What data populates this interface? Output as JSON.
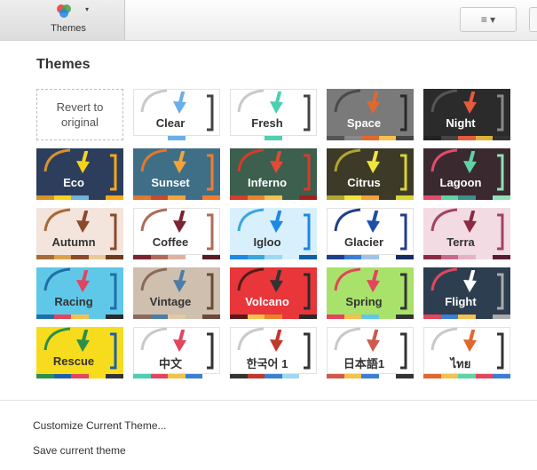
{
  "toolbar": {
    "themes_label": "Themes",
    "themes_caret": "▾",
    "menu_label": "≡ ▾",
    "logo_colors": [
      "#e53935",
      "#43a047",
      "#1e88e5"
    ]
  },
  "panel": {
    "title": "Themes",
    "revert_line1": "Revert to",
    "revert_line2": "original"
  },
  "themes": [
    {
      "name": "Clear",
      "bg": "#ffffff",
      "text": "#333333",
      "arc": "#c9c9c9",
      "arrow": "#6aaeea",
      "bracket": "#444444",
      "strip": [
        "#ffffff",
        "#ffffff",
        "#6aaeea",
        "#ffffff",
        "#ffffff"
      ]
    },
    {
      "name": "Fresh",
      "bg": "#ffffff",
      "text": "#333333",
      "arc": "#c9c9c9",
      "arrow": "#4dd0b1",
      "bracket": "#444444",
      "strip": [
        "#ffffff",
        "#ffffff",
        "#4dd0b1",
        "#ffffff",
        "#ffffff"
      ]
    },
    {
      "name": "Space",
      "bg": "#7a7a7a",
      "text": "#ffffff",
      "arc": "#4a4a4a",
      "arrow": "#e0682f",
      "bracket": "#2a2a2a",
      "strip": [
        "#555555",
        "#888888",
        "#e0682f",
        "#f2c14e",
        "#444444"
      ]
    },
    {
      "name": "Night",
      "bg": "#2b2b2b",
      "text": "#ffffff",
      "arc": "#555555",
      "arrow": "#e55b3c",
      "bracket": "#888888",
      "strip": [
        "#222222",
        "#444444",
        "#e55b3c",
        "#e0b03a",
        "#333333"
      ]
    },
    {
      "name": "Eco",
      "bg": "#2c3e5c",
      "text": "#ffffff",
      "arc": "#d9912b",
      "arrow": "#f7d21d",
      "bracket": "#f7a81d",
      "strip": [
        "#d9912b",
        "#f7d21d",
        "#6fb2dc",
        "#2c3e5c",
        "#f7a81d"
      ]
    },
    {
      "name": "Sunset",
      "bg": "#3f6f86",
      "text": "#ffffff",
      "arc": "#e0782f",
      "arrow": "#f2a33a",
      "bracket": "#f27b2f",
      "strip": [
        "#e0782f",
        "#c94a2e",
        "#f2a33a",
        "#3f6f86",
        "#f27b2f"
      ]
    },
    {
      "name": "Inferno",
      "bg": "#3c5f4e",
      "text": "#ffffff",
      "arc": "#d43c2c",
      "arrow": "#e14b33",
      "bracket": "#d43c2c",
      "strip": [
        "#d43c2c",
        "#e9822e",
        "#f2c14e",
        "#3c5f4e",
        "#a51f1f"
      ]
    },
    {
      "name": "Citrus",
      "bg": "#3d3a28",
      "text": "#ffffff",
      "arc": "#b0a531",
      "arrow": "#f0e63a",
      "bracket": "#d9d436",
      "strip": [
        "#b0a531",
        "#f0e63a",
        "#f2a33a",
        "#3d3a28",
        "#d9d436"
      ]
    },
    {
      "name": "Lagoon",
      "bg": "#3a2a2f",
      "text": "#ffffff",
      "arc": "#e24b6c",
      "arrow": "#5fd3a6",
      "bracket": "#8fe0b8",
      "strip": [
        "#e24b6c",
        "#5fd3a6",
        "#3a8f8a",
        "#3a2a2f",
        "#8fe0b8"
      ]
    },
    {
      "name": "Autumn",
      "bg": "#f3e4dc",
      "text": "#333333",
      "arc": "#a56b3a",
      "arrow": "#8b4a2b",
      "bracket": "#8b4a2b",
      "strip": [
        "#a56b3a",
        "#d9a24a",
        "#8b4a2b",
        "#e8c99a",
        "#6b3a20"
      ]
    },
    {
      "name": "Coffee",
      "bg": "#ffffff",
      "text": "#333333",
      "arc": "#b06a5a",
      "arrow": "#7b2233",
      "bracket": "#b06a5a",
      "strip": [
        "#7b2233",
        "#b06a5a",
        "#e0b0a0",
        "#ffffff",
        "#5a1a25"
      ]
    },
    {
      "name": "Igloo",
      "bg": "#d7f0fb",
      "text": "#333333",
      "arc": "#3aa7dc",
      "arrow": "#1e88e5",
      "bracket": "#1e88e5",
      "strip": [
        "#1e88e5",
        "#3aa7dc",
        "#9fd8f2",
        "#d7f0fb",
        "#0d5fa8"
      ]
    },
    {
      "name": "Glacier",
      "bg": "#ffffff",
      "text": "#333333",
      "arc": "#1f3f8a",
      "arrow": "#1e4fa8",
      "bracket": "#1f3f8a",
      "strip": [
        "#1f3f8a",
        "#3a7fd4",
        "#9fc2ea",
        "#ffffff",
        "#152c63"
      ]
    },
    {
      "name": "Terra",
      "bg": "#f2dbe3",
      "text": "#333333",
      "arc": "#a2445f",
      "arrow": "#8a2a45",
      "bracket": "#a2445f",
      "strip": [
        "#8a2a45",
        "#c66a87",
        "#e8b0c2",
        "#f2dbe3",
        "#5a1a2d"
      ]
    },
    {
      "name": "Racing",
      "bg": "#5fc8e8",
      "text": "#333333",
      "arc": "#1e6fa8",
      "arrow": "#e2455c",
      "bracket": "#1e6fa8",
      "strip": [
        "#1e6fa8",
        "#e2455c",
        "#f2c14e",
        "#5fc8e8",
        "#2a2a2a"
      ]
    },
    {
      "name": "Vintage",
      "bg": "#cfbfae",
      "text": "#333333",
      "arc": "#8a6a5a",
      "arrow": "#4a7ea8",
      "bracket": "#6a4a3a",
      "strip": [
        "#8a6a5a",
        "#4a7ea8",
        "#e0c9a8",
        "#cfbfae",
        "#6a4a3a"
      ]
    },
    {
      "name": "Volcano",
      "bg": "#e8363a",
      "text": "#ffffff",
      "arc": "#5a1a1a",
      "arrow": "#333333",
      "bracket": "#2a2a2a",
      "strip": [
        "#5a1a1a",
        "#f2c14e",
        "#e9822e",
        "#e8363a",
        "#2a2a2a"
      ]
    },
    {
      "name": "Spring",
      "bg": "#a8e26a",
      "text": "#333333",
      "arc": "#e2455c",
      "arrow": "#e2455c",
      "bracket": "#333333",
      "strip": [
        "#e2455c",
        "#f2c14e",
        "#5fc8e8",
        "#a8e26a",
        "#333333"
      ]
    },
    {
      "name": "Flight",
      "bg": "#2c3e50",
      "text": "#ffffff",
      "arc": "#e2455c",
      "arrow": "#ffffff",
      "bracket": "#aaaaaa",
      "strip": [
        "#e2455c",
        "#3a7fd4",
        "#f2c14e",
        "#2c3e50",
        "#aaaaaa"
      ]
    },
    {
      "name": "Rescue",
      "bg": "#f7dc1d",
      "text": "#333333",
      "arc": "#2a8f4a",
      "arrow": "#2a8f4a",
      "bracket": "#1e5fa8",
      "strip": [
        "#2a8f4a",
        "#1e5fa8",
        "#e2455c",
        "#f7dc1d",
        "#333333"
      ]
    },
    {
      "name": "中文",
      "bg": "#ffffff",
      "text": "#333333",
      "arc": "#c9c9c9",
      "arrow": "#e2455c",
      "bracket": "#333333",
      "strip": [
        "#4dd0b1",
        "#e2455c",
        "#f2c14e",
        "#3a7fd4",
        "#ffffff"
      ]
    },
    {
      "name": "한국어 1",
      "bg": "#ffffff",
      "text": "#333333",
      "arc": "#c9c9c9",
      "arrow": "#c0392b",
      "bracket": "#333333",
      "strip": [
        "#333333",
        "#c0392b",
        "#3a7fd4",
        "#9fd8f2",
        "#ffffff"
      ]
    },
    {
      "name": "日本語1",
      "bg": "#ffffff",
      "text": "#333333",
      "arc": "#c9c9c9",
      "arrow": "#d0584c",
      "bracket": "#333333",
      "strip": [
        "#d0584c",
        "#f2c14e",
        "#3a7fd4",
        "#ffffff",
        "#333333"
      ]
    },
    {
      "name": "ไทย",
      "bg": "#ffffff",
      "text": "#333333",
      "arc": "#c9c9c9",
      "arrow": "#e0682f",
      "bracket": "#333333",
      "strip": [
        "#e0682f",
        "#f2c14e",
        "#5fd3a6",
        "#e2455c",
        "#3a7fd4"
      ]
    }
  ],
  "footer": {
    "customize": "Customize Current Theme...",
    "save": "Save current theme"
  }
}
